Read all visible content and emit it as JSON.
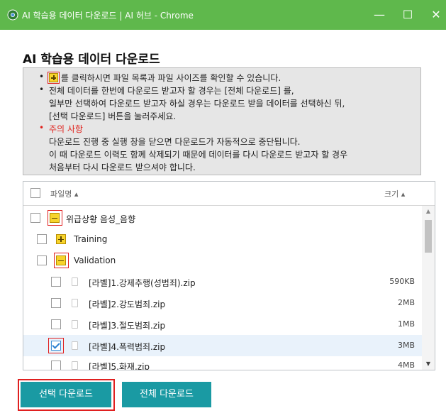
{
  "window": {
    "title": "AI 학습용 데이터 다운로드 | AI 허브 - Chrome",
    "minimize_glyph": "—",
    "maximize_glyph": "☐",
    "close_glyph": "✕",
    "app_icon": "chrome-icon"
  },
  "page": {
    "heading": "AI 학습용 데이터 다운로드"
  },
  "info": {
    "line1_suffix": "를 클릭하시면 파일 목록과 파일 사이즈를 확인할 수 있습니다.",
    "line2": "전체 데이터를 한번에 다운로드 받고자 할 경우는 [전체 다운로드] 를,",
    "line3": "일부만 선택하여 다운로드 받고자 하실 경우는 다운로드 받을 데이터를 선택하신 뒤,",
    "line4": "[선택 다운로드] 버튼을 눌러주세요.",
    "warning_title": "주의 사항",
    "line6": "다운로드 진행 중 실행 창을 닫으면 다운로드가 자동적으로 중단됩니다.",
    "line7": "이 때 다운로드 이력도 함께 삭제되기 때문에 데이터를 다시 다운로드 받고자 할 경우",
    "line8": "처음부터 다시 다운로드 받으셔야 합니다.",
    "bullet_glyph": "•"
  },
  "file_list": {
    "header_name": "파일명 ▴",
    "header_size": "크기 ▴",
    "rows": [
      {
        "label": "위급상황 음성_음향",
        "size": "",
        "checked": false
      },
      {
        "label": "Training",
        "size": "",
        "checked": false
      },
      {
        "label": "Validation",
        "size": "",
        "checked": false
      },
      {
        "label": "[라벨]1.강제추행(성범죄).zip",
        "size": "590KB",
        "checked": false
      },
      {
        "label": "[라벨]2.강도범죄.zip",
        "size": "2MB",
        "checked": false
      },
      {
        "label": "[라벨]3.절도범죄.zip",
        "size": "1MB",
        "checked": false
      },
      {
        "label": "[라벨]4.폭력범죄.zip",
        "size": "3MB",
        "checked": true
      },
      {
        "label": "[라벨]5.화재.zip",
        "size": "4MB",
        "checked": false
      }
    ],
    "scroll_up_glyph": "▲",
    "scroll_down_glyph": "▼"
  },
  "buttons": {
    "selected_download": "선택 다운로드",
    "all_download": "전체 다운로드"
  },
  "colors": {
    "titlebar": "#5fb84c",
    "button": "#1a9aa3",
    "highlight": "#e02020",
    "warning": "#e0201a",
    "selected_row": "#e9f2fb"
  }
}
